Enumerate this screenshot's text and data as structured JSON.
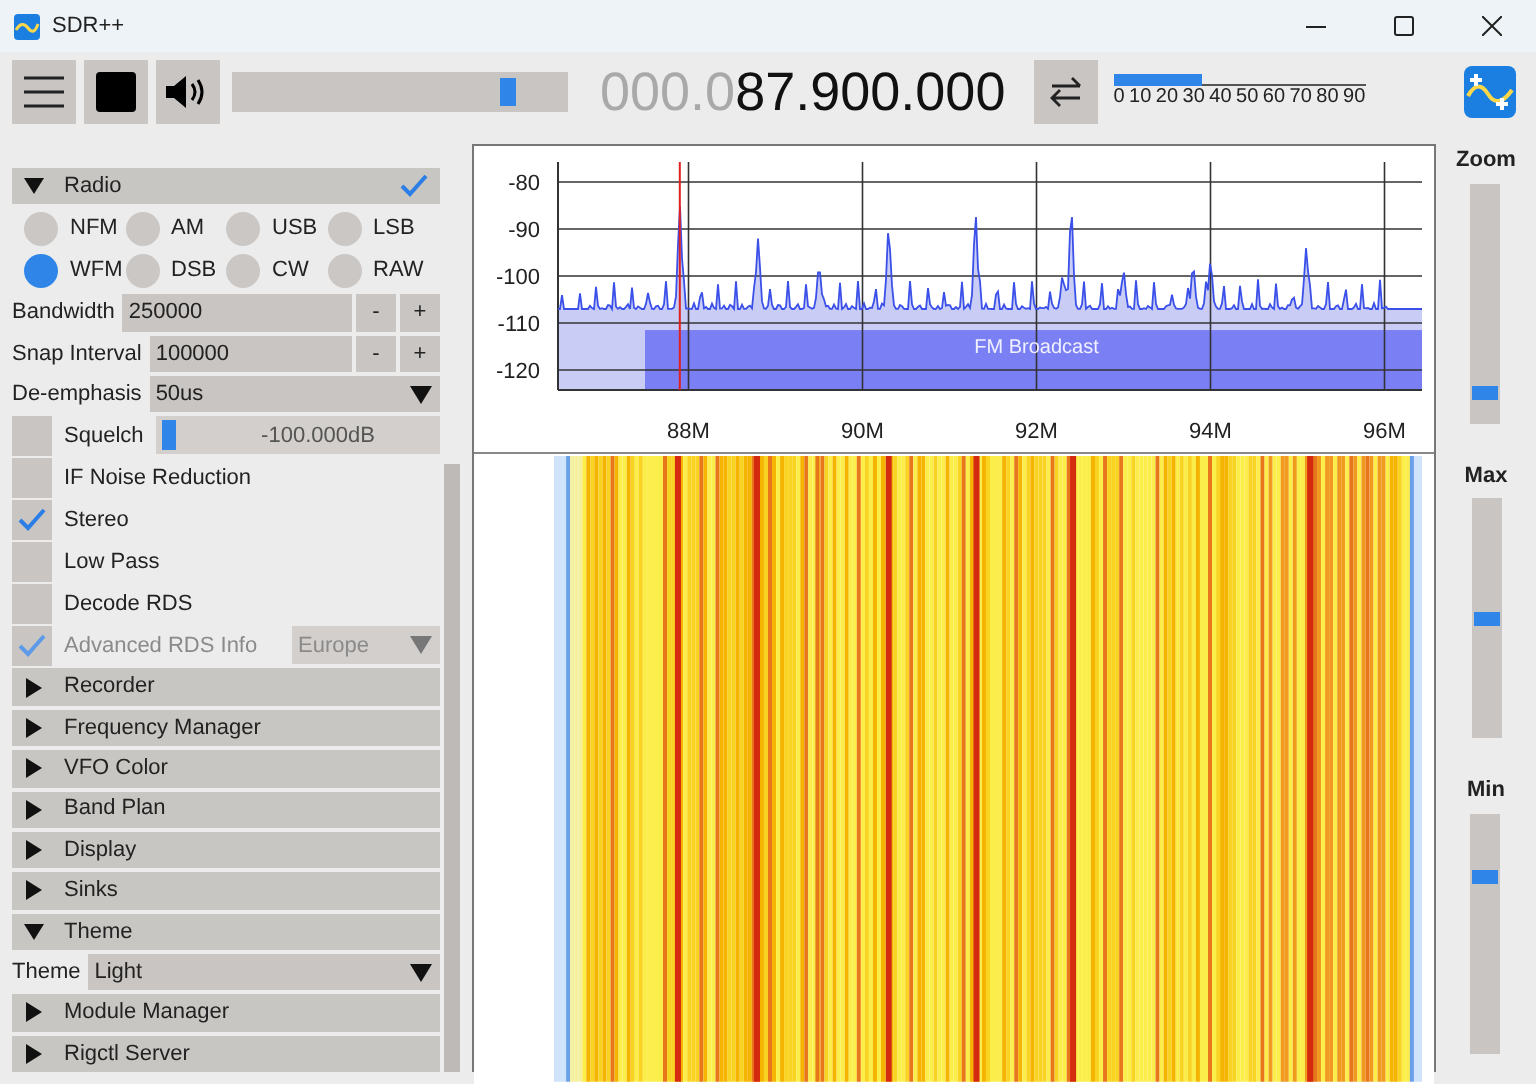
{
  "window": {
    "title": "SDR++"
  },
  "toolbar": {
    "volume": {
      "level": 0.84
    },
    "frequency": {
      "dim": "000.0",
      "bright": "87.900.000"
    },
    "meter": {
      "level": 0.35,
      "ticks": [
        "0",
        "10",
        "20",
        "30",
        "40",
        "50",
        "60",
        "70",
        "80",
        "90"
      ]
    }
  },
  "sidebar": {
    "rows": [
      {
        "kind": "header",
        "label": "Radio",
        "expanded": true,
        "checked": true
      },
      {
        "kind": "radios",
        "options": [
          {
            "label": "NFM",
            "selected": false
          },
          {
            "label": "AM",
            "selected": false
          },
          {
            "label": "USB",
            "selected": false
          },
          {
            "label": "LSB",
            "selected": false
          },
          {
            "label": "WFM",
            "selected": true
          },
          {
            "label": "DSB",
            "selected": false
          },
          {
            "label": "CW",
            "selected": false
          },
          {
            "label": "RAW",
            "selected": false
          }
        ]
      },
      {
        "kind": "number",
        "label": "Bandwidth",
        "value": "250000",
        "minus": "-",
        "plus": "+"
      },
      {
        "kind": "number",
        "label": "Snap Interval",
        "value": "100000",
        "minus": "-",
        "plus": "+"
      },
      {
        "kind": "select",
        "label": "De-emphasis",
        "value": "50us"
      },
      {
        "kind": "slider",
        "label": "Squelch",
        "checked": false,
        "level": 0.02,
        "reading": "-100.000dB"
      },
      {
        "kind": "checkbox",
        "label": "IF Noise Reduction",
        "checked": false
      },
      {
        "kind": "checkbox",
        "label": "Stereo",
        "checked": true
      },
      {
        "kind": "checkbox",
        "label": "Low Pass",
        "checked": false
      },
      {
        "kind": "checkbox",
        "label": "Decode RDS",
        "checked": false
      },
      {
        "kind": "checkbox",
        "label": "Advanced RDS Info",
        "checked": true,
        "disabled": true,
        "value": "Europe"
      },
      {
        "kind": "header",
        "label": "Recorder",
        "expanded": false
      },
      {
        "kind": "header",
        "label": "Frequency Manager",
        "expanded": false
      },
      {
        "kind": "header",
        "label": "VFO Color",
        "expanded": false
      },
      {
        "kind": "header",
        "label": "Band Plan",
        "expanded": false
      },
      {
        "kind": "header",
        "label": "Display",
        "expanded": false
      },
      {
        "kind": "header",
        "label": "Sinks",
        "expanded": false
      },
      {
        "kind": "header",
        "label": "Theme",
        "expanded": true
      },
      {
        "kind": "select",
        "label": "Theme",
        "value": "Light"
      },
      {
        "kind": "header",
        "label": "Module Manager",
        "expanded": false
      },
      {
        "kind": "header",
        "label": "Rigctl Server",
        "expanded": false
      }
    ]
  },
  "spectrum": {
    "y_labels": [
      "-80",
      "-90",
      "-100",
      "-110",
      "-120"
    ],
    "x_labels": [
      "88M",
      "90M",
      "92M",
      "94M",
      "96M"
    ],
    "band": "FM Broadcast"
  },
  "right_panel": {
    "sliders": [
      {
        "label": "Zoom",
        "level": 0.1
      },
      {
        "label": "Max",
        "level": 0.5
      },
      {
        "label": "Min",
        "level": 0.75
      }
    ]
  }
}
